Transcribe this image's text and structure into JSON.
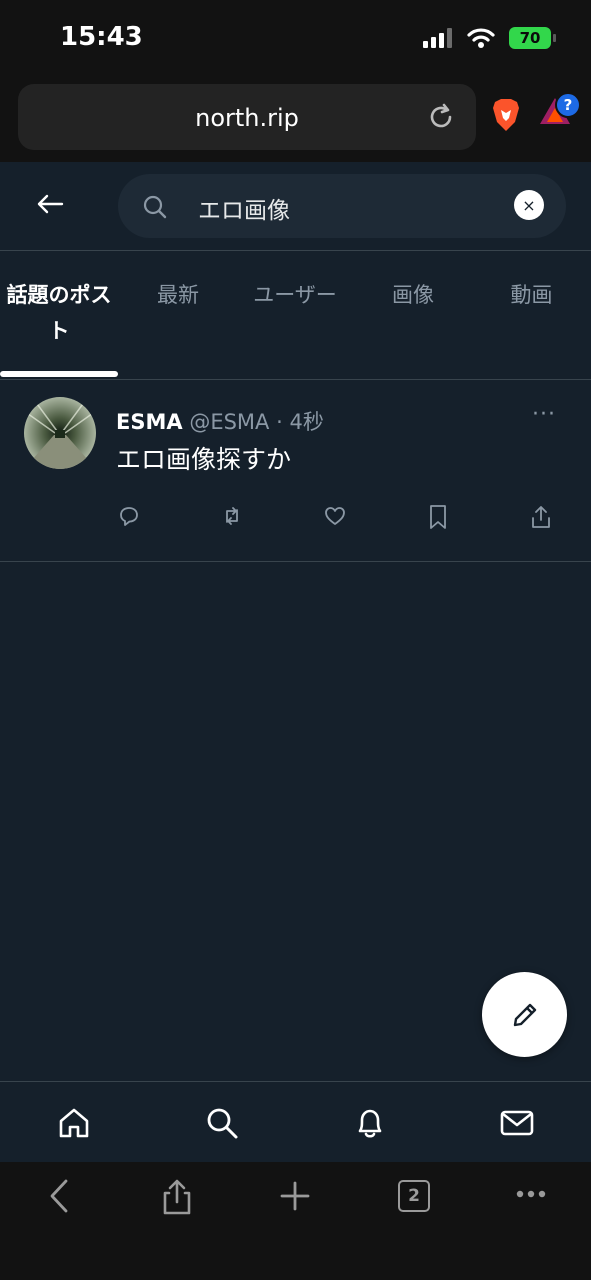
{
  "status_bar": {
    "time": "15:43",
    "battery": "70"
  },
  "browser": {
    "url": "north.rip",
    "tab_count": "2",
    "rewards_badge": "?"
  },
  "search": {
    "query": "エロ画像",
    "clear_label": "×"
  },
  "tabs": [
    {
      "label": "話題のポスト",
      "active": true
    },
    {
      "label": "最新"
    },
    {
      "label": "ユーザー"
    },
    {
      "label": "画像"
    },
    {
      "label": "動画"
    }
  ],
  "post": {
    "name": "ESMA",
    "handle": "@ESMA",
    "separator": "·",
    "time": "4秒",
    "text": "エロ画像探すか",
    "more": "···"
  },
  "colors": {
    "background": "#15202b",
    "border": "#38444d",
    "muted": "#8b98a5",
    "battery": "#32d74b"
  }
}
